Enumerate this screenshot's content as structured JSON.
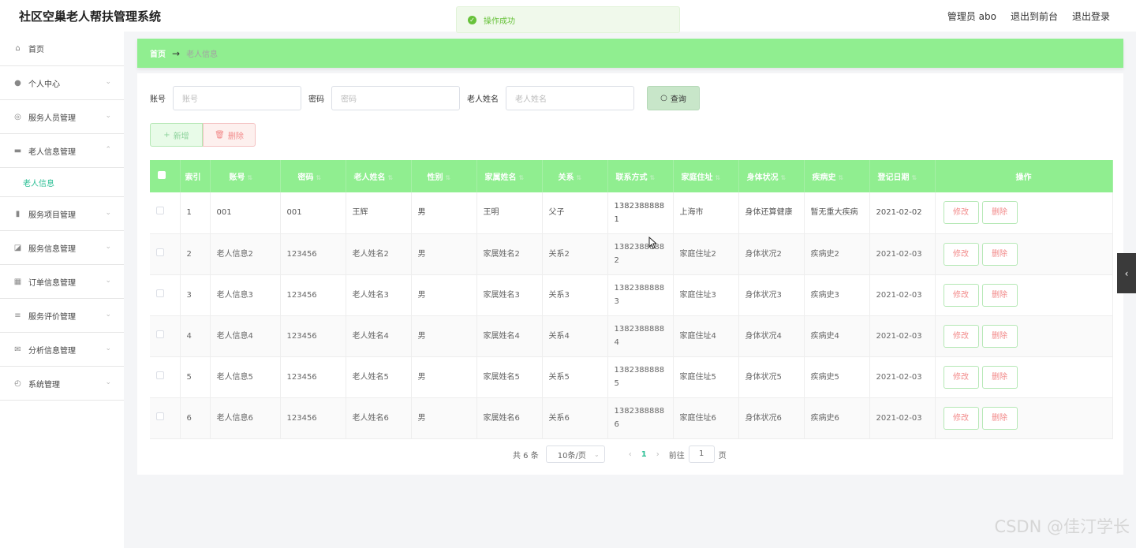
{
  "app": {
    "title": "社区空巢老人帮扶管理系统"
  },
  "top_links": {
    "role_user": "管理员 abo",
    "exit_front": "退出到前台",
    "logout": "退出登录"
  },
  "toast": {
    "text": "操作成功",
    "color": "#67c23a"
  },
  "sidebar": {
    "items": [
      {
        "label": "首页",
        "icon": "home-icon"
      },
      {
        "label": "个人中心",
        "icon": "user-icon"
      },
      {
        "label": "服务人员管理",
        "icon": "target-icon"
      },
      {
        "label": "老人信息管理",
        "icon": "monitor-icon"
      },
      {
        "label": "服务项目管理",
        "icon": "bar-chart-icon"
      },
      {
        "label": "服务信息管理",
        "icon": "chart-icon"
      },
      {
        "label": "订单信息管理",
        "icon": "grid-icon"
      },
      {
        "label": "服务评价管理",
        "icon": "list-icon"
      },
      {
        "label": "分析信息管理",
        "icon": "mail-icon"
      },
      {
        "label": "系统管理",
        "icon": "compass-icon"
      }
    ],
    "active_sub": "老人信息"
  },
  "breadcrumb": {
    "home": "首页",
    "current": "老人信息"
  },
  "search": {
    "account_label": "账号",
    "account_placeholder": "账号",
    "password_label": "密码",
    "password_placeholder": "密码",
    "name_label": "老人姓名",
    "name_placeholder": "老人姓名",
    "button": "查询"
  },
  "actions": {
    "add": "新增",
    "delete": "删除"
  },
  "table": {
    "headers": [
      "索引",
      "账号",
      "密码",
      "老人姓名",
      "性别",
      "家属姓名",
      "关系",
      "联系方式",
      "家庭住址",
      "身体状况",
      "疾病史",
      "登记日期",
      "操作"
    ],
    "rows": [
      {
        "idx": "1",
        "account": "001",
        "password": "001",
        "name": "王辉",
        "gender": "男",
        "family": "王明",
        "relation": "父子",
        "phone_a": "1382388888",
        "phone_b": "1",
        "address": "上海市",
        "health": "身体还算健康",
        "disease": "暂无重大疾病",
        "date": "2021-02-02"
      },
      {
        "idx": "2",
        "account": "老人信息2",
        "password": "123456",
        "name": "老人姓名2",
        "gender": "男",
        "family": "家属姓名2",
        "relation": "关系2",
        "phone_a": "1382388888",
        "phone_b": "2",
        "address": "家庭住址2",
        "health": "身体状况2",
        "disease": "疾病史2",
        "date": "2021-02-03"
      },
      {
        "idx": "3",
        "account": "老人信息3",
        "password": "123456",
        "name": "老人姓名3",
        "gender": "男",
        "family": "家属姓名3",
        "relation": "关系3",
        "phone_a": "1382388888",
        "phone_b": "3",
        "address": "家庭住址3",
        "health": "身体状况3",
        "disease": "疾病史3",
        "date": "2021-02-03"
      },
      {
        "idx": "4",
        "account": "老人信息4",
        "password": "123456",
        "name": "老人姓名4",
        "gender": "男",
        "family": "家属姓名4",
        "relation": "关系4",
        "phone_a": "1382388888",
        "phone_b": "4",
        "address": "家庭住址4",
        "health": "身体状况4",
        "disease": "疾病史4",
        "date": "2021-02-03"
      },
      {
        "idx": "5",
        "account": "老人信息5",
        "password": "123456",
        "name": "老人姓名5",
        "gender": "男",
        "family": "家属姓名5",
        "relation": "关系5",
        "phone_a": "1382388888",
        "phone_b": "5",
        "address": "家庭住址5",
        "health": "身体状况5",
        "disease": "疾病史5",
        "date": "2021-02-03"
      },
      {
        "idx": "6",
        "account": "老人信息6",
        "password": "123456",
        "name": "老人姓名6",
        "gender": "男",
        "family": "家属姓名6",
        "relation": "关系6",
        "phone_a": "1382388888",
        "phone_b": "6",
        "address": "家庭住址6",
        "health": "身体状况6",
        "disease": "疾病史6",
        "date": "2021-02-03"
      }
    ],
    "edit_label": "修改",
    "delete_label": "删除"
  },
  "pagination": {
    "total": "共 6 条",
    "page_size": "10条/页",
    "current_page": "1",
    "goto_label": "前往",
    "goto_value": "1",
    "page_suffix": "页"
  },
  "watermark": "CSDN @佳汀学长",
  "theme": {
    "accent_green": "#90ee90",
    "active_text": "#2cbf95",
    "danger": "#f28a8a"
  }
}
